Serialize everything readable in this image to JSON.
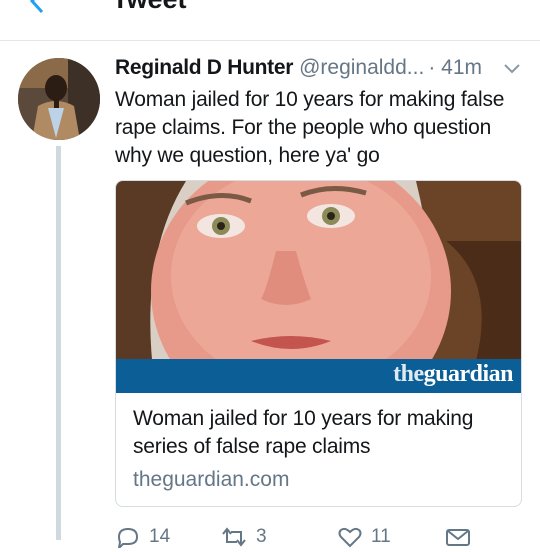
{
  "header": {
    "title": "Tweet"
  },
  "tweet": {
    "display_name": "Reginald D Hunter",
    "handle": "@reginaldd...",
    "time": "· 41m",
    "text": "Woman jailed for 10 years for making false rape claims. For the people who question why we question, here ya' go"
  },
  "card": {
    "logo_the": "the",
    "logo_guardian": "guardian",
    "title": "Woman jailed for 10 years for making series of false rape claims",
    "domain": "theguardian.com"
  },
  "actions": {
    "reply_count": "14",
    "retweet_count": "3",
    "like_count": "11"
  },
  "colors": {
    "accent": "#1da1f2",
    "secondary_text": "#657786",
    "guardian_blue": "#0b5e96"
  }
}
